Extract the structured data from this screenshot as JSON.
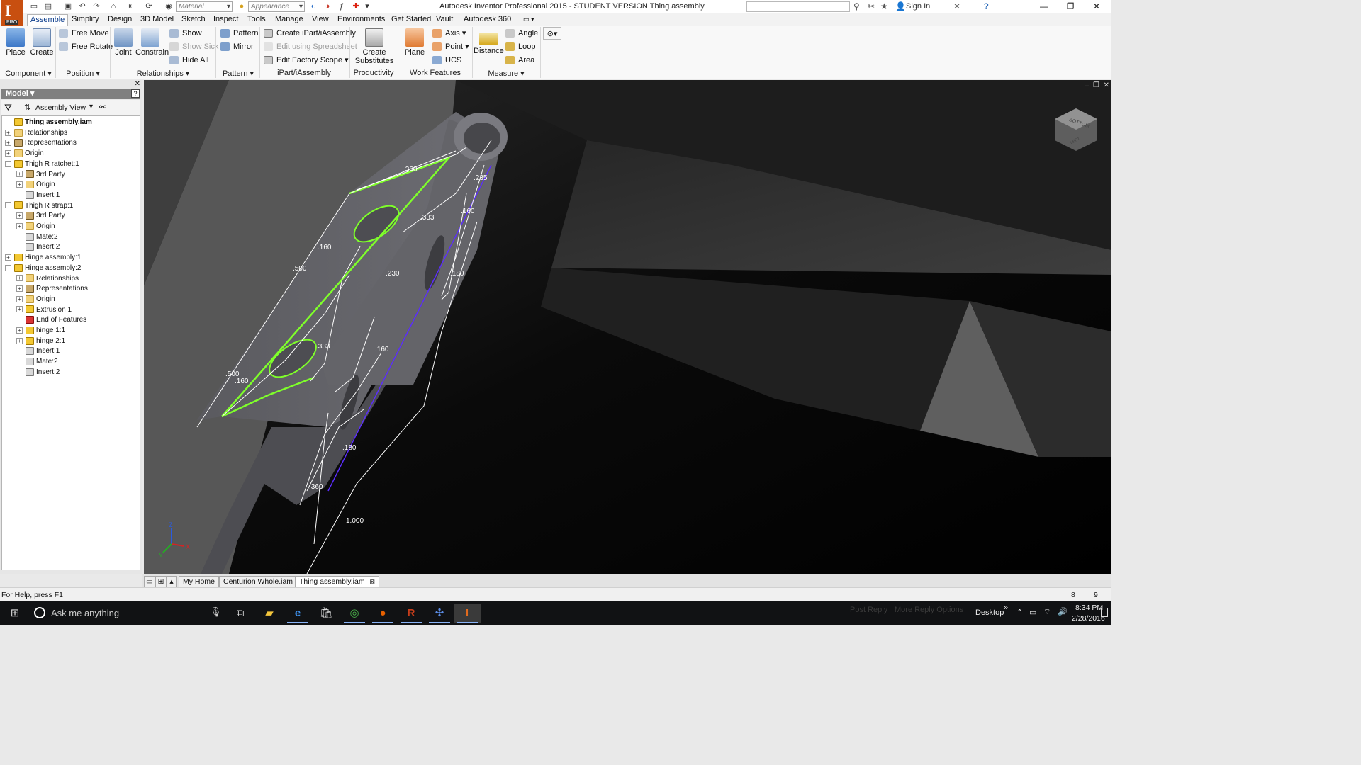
{
  "window": {
    "title": "Autodesk Inventor Professional 2015 - STUDENT VERSION    Thing assembly",
    "qat_material": "Material",
    "qat_appearance": "Appearance",
    "sign_in": "Sign In",
    "logo_badge": "PRO"
  },
  "ribbon_tabs": [
    "Assemble",
    "Simplify",
    "Design",
    "3D Model",
    "Sketch",
    "Inspect",
    "Tools",
    "Manage",
    "View",
    "Environments",
    "Get Started",
    "Vault",
    "Autodesk 360"
  ],
  "ribbon": {
    "component": {
      "title": "Component",
      "place": "Place",
      "create": "Create"
    },
    "position": {
      "title": "Position",
      "free_move": "Free Move",
      "free_rotate": "Free Rotate"
    },
    "relationships": {
      "title": "Relationships",
      "joint": "Joint",
      "constrain": "Constrain",
      "show": "Show",
      "show_sick": "Show Sick",
      "hide_all": "Hide All"
    },
    "pattern": {
      "title": "Pattern",
      "pattern": "Pattern",
      "mirror": "Mirror"
    },
    "ipart": {
      "title": "iPart/iAssembly",
      "create": "Create iPart/iAssembly",
      "edit_spreadsheet": "Edit using Spreadsheet",
      "edit_factory": "Edit Factory Scope"
    },
    "productivity": {
      "title": "Productivity",
      "create_substitutes_1": "Create",
      "create_substitutes_2": "Substitutes"
    },
    "work_features": {
      "title": "Work Features",
      "plane": "Plane",
      "axis": "Axis",
      "point": "Point",
      "ucs": "UCS"
    },
    "measure": {
      "title": "Measure",
      "distance": "Distance",
      "angle": "Angle",
      "loop": "Loop",
      "area": "Area"
    }
  },
  "browser": {
    "title": "Model",
    "view": "Assembly View",
    "tree": [
      {
        "label": "Thing assembly.iam",
        "level": 0,
        "icon": "assembly",
        "exp": ""
      },
      {
        "label": "Relationships",
        "level": 0,
        "icon": "folder",
        "exp": "+"
      },
      {
        "label": "Representations",
        "level": 0,
        "icon": "reps",
        "exp": "+"
      },
      {
        "label": "Origin",
        "level": 0,
        "icon": "folder",
        "exp": "+"
      },
      {
        "label": "Thigh R ratchet:1",
        "level": 0,
        "icon": "part",
        "exp": "−"
      },
      {
        "label": "3rd Party",
        "level": 1,
        "icon": "reps",
        "exp": "+"
      },
      {
        "label": "Origin",
        "level": 1,
        "icon": "folder",
        "exp": "+"
      },
      {
        "label": "Insert:1",
        "level": 1,
        "icon": "constraint",
        "exp": ""
      },
      {
        "label": "Thigh R strap:1",
        "level": 0,
        "icon": "part",
        "exp": "−"
      },
      {
        "label": "3rd Party",
        "level": 1,
        "icon": "reps",
        "exp": "+"
      },
      {
        "label": "Origin",
        "level": 1,
        "icon": "folder",
        "exp": "+"
      },
      {
        "label": "Mate:2",
        "level": 1,
        "icon": "constraint",
        "exp": ""
      },
      {
        "label": "Insert:2",
        "level": 1,
        "icon": "constraint",
        "exp": ""
      },
      {
        "label": "Hinge assembly:1",
        "level": 0,
        "icon": "part",
        "exp": "+"
      },
      {
        "label": "Hinge assembly:2",
        "level": 0,
        "icon": "part",
        "exp": "−"
      },
      {
        "label": "Relationships",
        "level": 1,
        "icon": "folder",
        "exp": "+"
      },
      {
        "label": "Representations",
        "level": 1,
        "icon": "reps",
        "exp": "+"
      },
      {
        "label": "Origin",
        "level": 1,
        "icon": "folder",
        "exp": "+"
      },
      {
        "label": "Extrusion 1",
        "level": 1,
        "icon": "part",
        "exp": "+"
      },
      {
        "label": "End of Features",
        "level": 1,
        "icon": "errorn",
        "exp": ""
      },
      {
        "label": "hinge 1:1",
        "level": 1,
        "icon": "part",
        "exp": "+"
      },
      {
        "label": "hinge 2:1",
        "level": 1,
        "icon": "part",
        "exp": "+"
      },
      {
        "label": "Insert:1",
        "level": 1,
        "icon": "constraint",
        "exp": ""
      },
      {
        "label": "Mate:2",
        "level": 1,
        "icon": "constraint",
        "exp": ""
      },
      {
        "label": "Insert:2",
        "level": 1,
        "icon": "constraint",
        "exp": ""
      }
    ]
  },
  "viewport": {
    "dimensions": [
      ".360",
      ".235",
      ".333",
      ".160",
      ".160",
      ".500",
      ".230",
      ".180",
      ".333",
      ".160",
      ".500",
      ".160",
      ".180",
      ".360",
      "1.000"
    ],
    "viewcube_top": "BOTTOM",
    "viewcube_side": "LEFT"
  },
  "doc_tabs": [
    "My Home",
    "Centurion Whole.iam",
    "Thing assembly.iam"
  ],
  "status": {
    "help": "For Help, press F1",
    "num1": "8",
    "num2": "9"
  },
  "taskbar": {
    "search_placeholder": "Ask me anything",
    "desktop": "Desktop",
    "post_reply": "Post Reply",
    "more_reply": "More Reply Options",
    "time": "8:34 PM",
    "date": "2/28/2016"
  }
}
